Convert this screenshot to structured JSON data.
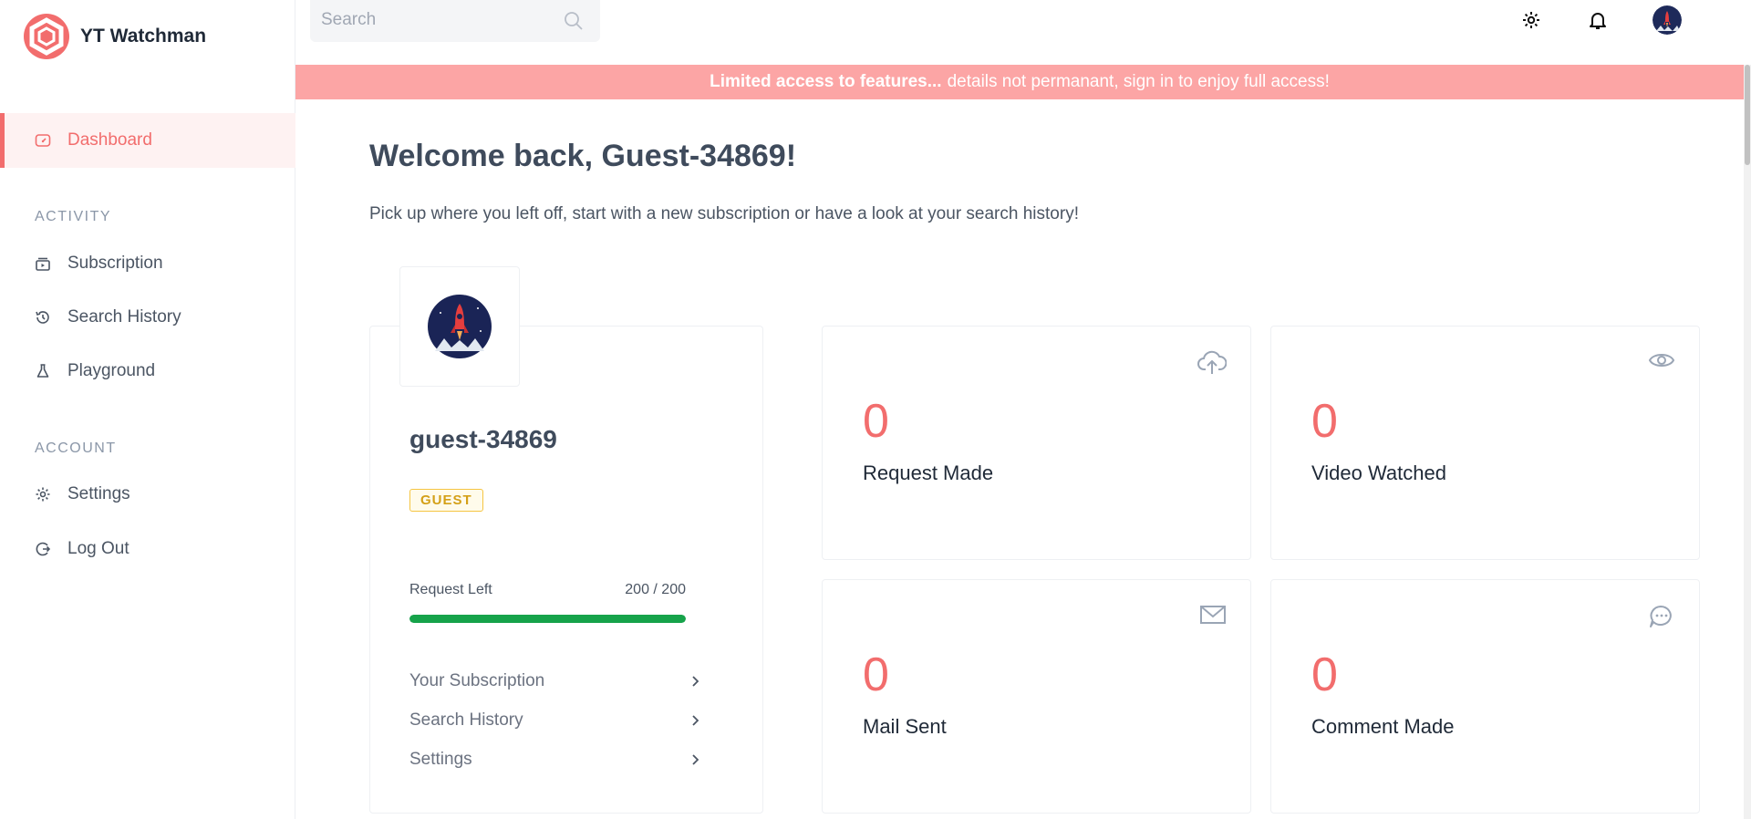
{
  "app": {
    "name": "YT Watchman"
  },
  "sidebar": {
    "dashboard": "Dashboard",
    "activity_label": "ACTIVITY",
    "account_label": "ACCOUNT",
    "items": [
      {
        "label": "Subscription",
        "icon": "subscription-icon"
      },
      {
        "label": "Search History",
        "icon": "history-icon"
      },
      {
        "label": "Playground",
        "icon": "flask-icon"
      },
      {
        "label": "Settings",
        "icon": "gear-icon"
      },
      {
        "label": "Log Out",
        "icon": "logout-icon"
      }
    ]
  },
  "topbar": {
    "search_placeholder": "Search"
  },
  "banner": {
    "bold": "Limited access to features...",
    "text": "details not permanant, sign in to enjoy full access!"
  },
  "main": {
    "welcome": "Welcome back, Guest-34869!",
    "subtitle": "Pick up where you left off, start with a new subscription or have a look at your search history!"
  },
  "profile": {
    "username": "guest-34869",
    "badge": "GUEST",
    "request_left_label": "Request Left",
    "request_left_value": "200 / 200",
    "request_left_fraction": 1.0,
    "links": [
      "Your Subscription",
      "Search History",
      "Settings"
    ]
  },
  "stats": [
    {
      "value": "0",
      "label": "Request Made",
      "icon": "cloud-upload-icon"
    },
    {
      "value": "0",
      "label": "Video Watched",
      "icon": "eye-icon"
    },
    {
      "value": "0",
      "label": "Mail Sent",
      "icon": "mail-icon"
    },
    {
      "value": "0",
      "label": "Comment Made",
      "icon": "chat-icon"
    }
  ],
  "colors": {
    "accent": "#f26d6d",
    "banner": "#fca5a5",
    "progress": "#16a34a",
    "badge": "#d4a017"
  }
}
